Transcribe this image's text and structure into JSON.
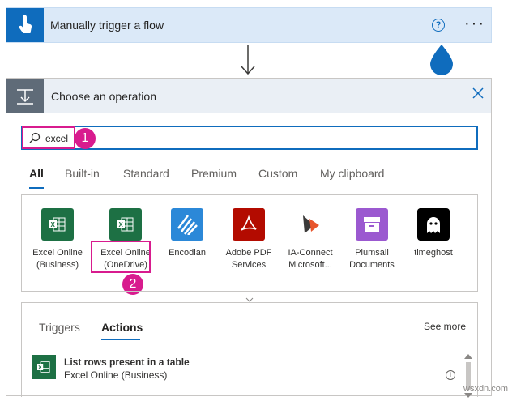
{
  "trigger": {
    "title": "Manually trigger a flow",
    "help_icon": "help-circle-icon",
    "more_icon": "ellipsis-icon",
    "accent": "#0f6cbd"
  },
  "panel": {
    "title": "Choose an operation",
    "search": {
      "value": "excel"
    },
    "badge1": "1",
    "badge2": "2",
    "tabs": [
      "All",
      "Built-in",
      "Standard",
      "Premium",
      "Custom",
      "My clipboard"
    ],
    "connectors": [
      {
        "line1": "Excel Online",
        "line2": "(Business)",
        "color": "#1d7044"
      },
      {
        "line1": "Excel Online",
        "line2": "(OneDrive)",
        "color": "#1d7044"
      },
      {
        "line1": "Encodian",
        "line2": "",
        "color": "#2b88d8"
      },
      {
        "line1": "Adobe PDF",
        "line2": "Services",
        "color": "#b30b00"
      },
      {
        "line1": "IA-Connect",
        "line2": "Microsoft...",
        "color": "#ffffff"
      },
      {
        "line1": "Plumsail",
        "line2": "Documents",
        "color": "#9b59d0"
      },
      {
        "line1": "timeghost",
        "line2": "",
        "color": "#000000"
      }
    ],
    "subtabs": [
      "Triggers",
      "Actions"
    ],
    "see_more": "See more",
    "action": {
      "title": "List rows present in a table",
      "subtitle": "Excel Online (Business)"
    }
  },
  "highlight_color": "#d81b8e",
  "watermark": "wsxdn.com"
}
